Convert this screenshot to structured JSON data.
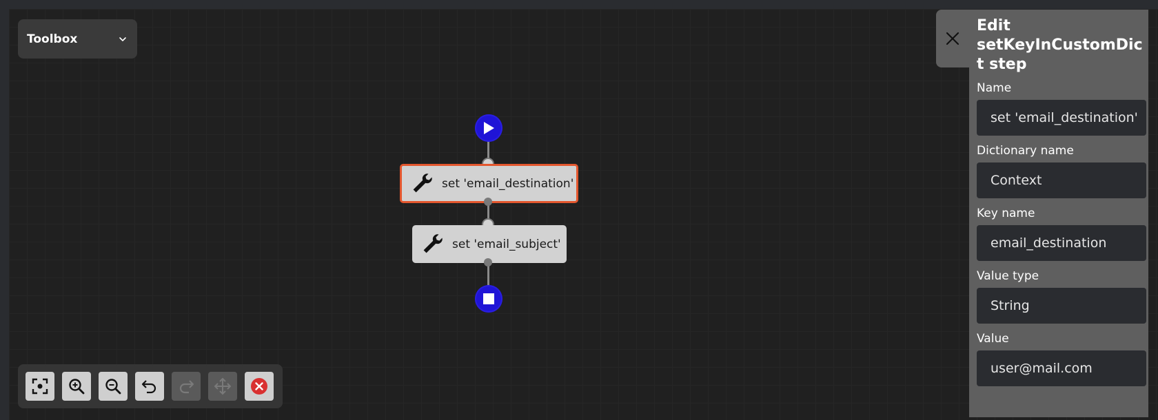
{
  "toolbox": {
    "label": "Toolbox",
    "icon": "chevron-down-icon"
  },
  "workflow": {
    "start_icon": "play-icon",
    "end_icon": "stop-icon",
    "steps": [
      {
        "label": "set 'email_destination'",
        "icon": "wrench-icon",
        "selected": true
      },
      {
        "label": "set 'email_subject'",
        "icon": "wrench-icon",
        "selected": false
      }
    ]
  },
  "toolbar": {
    "buttons": [
      {
        "name": "center-view",
        "icon": "focus-icon",
        "enabled": true
      },
      {
        "name": "zoom-in",
        "icon": "zoom-in-icon",
        "enabled": true
      },
      {
        "name": "zoom-out",
        "icon": "zoom-out-icon",
        "enabled": true
      },
      {
        "name": "undo",
        "icon": "undo-icon",
        "enabled": true
      },
      {
        "name": "redo",
        "icon": "redo-icon",
        "enabled": false
      },
      {
        "name": "move",
        "icon": "move-icon",
        "enabled": false
      },
      {
        "name": "delete",
        "icon": "delete-icon",
        "enabled": true
      }
    ]
  },
  "panel": {
    "title": "Edit setKeyInCustomDict step",
    "close_icon": "close-icon",
    "fields": {
      "name": {
        "label": "Name",
        "value": "set 'email_destination'"
      },
      "dictionary": {
        "label": "Dictionary name",
        "value": "Context"
      },
      "key": {
        "label": "Key name",
        "value": "email_destination"
      },
      "value_type": {
        "label": "Value type",
        "value": "String"
      },
      "value": {
        "label": "Value",
        "value": "user@mail.com"
      }
    }
  },
  "colors": {
    "canvas": "#202020",
    "terminal": "#1f14d6",
    "selected_border": "#e4572e",
    "delete": "#d93030",
    "panel": "#5f5f5f"
  }
}
